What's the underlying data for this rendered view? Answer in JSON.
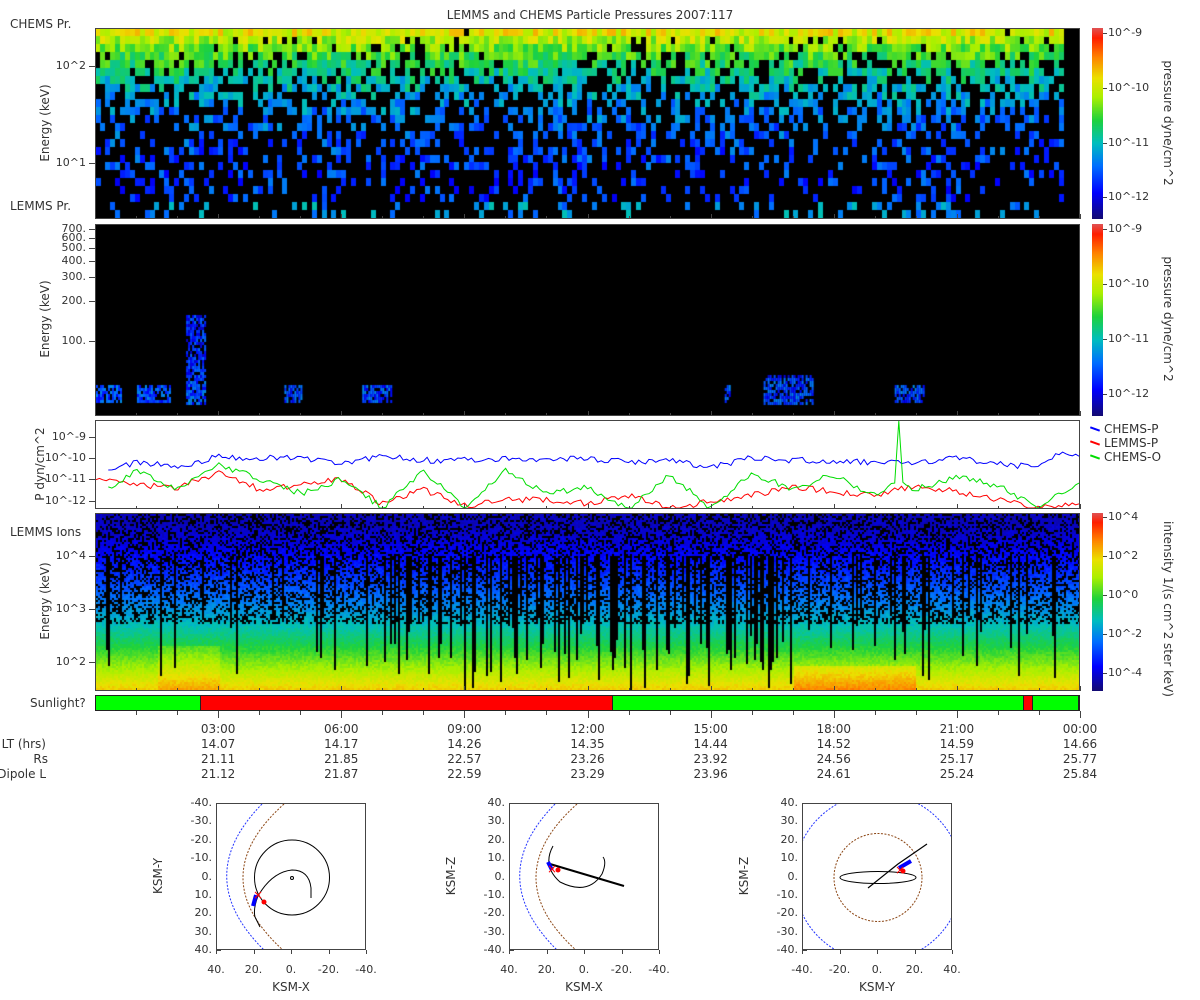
{
  "title": "LEMMS and CHEMS Particle Pressures  2007:117",
  "panel_labels": {
    "chems_pr": "CHEMS Pr.",
    "lemms_pr": "LEMMS Pr.",
    "lemms_ions": "LEMMS Ions",
    "sunlight": "Sunlight?"
  },
  "colors": {
    "chems_p": "#0000ff",
    "lemms_p": "#ff0000",
    "chems_o": "#00dd00",
    "sunlit": "#00ff00",
    "shadow": "#ff0000"
  },
  "chart_data": [
    {
      "type": "heatmap",
      "name": "CHEMS Pr.",
      "ylabel": "Energy (keV)",
      "yscale": "log",
      "ylim": [
        2.6,
        250
      ],
      "yticks": [
        {
          "v": 100,
          "label": "10^2"
        },
        {
          "v": 10,
          "label": "10^1"
        }
      ],
      "colorbar": {
        "label": "pressure dyne/cm^2",
        "log_range": [
          -12.4,
          -8.9
        ],
        "ticks": [
          {
            "v": -9,
            "label": "10^-9"
          },
          {
            "v": -10,
            "label": "10^-10"
          },
          {
            "v": -11,
            "label": "10^-11"
          },
          {
            "v": -12,
            "label": "10^-12"
          }
        ]
      }
    },
    {
      "type": "heatmap",
      "name": "LEMMS Pr.",
      "ylabel": "Energy (keV)",
      "yscale": "log",
      "ylim": [
        27,
        760
      ],
      "yticks": [
        {
          "v": 700,
          "label": "700."
        },
        {
          "v": 600,
          "label": "600."
        },
        {
          "v": 500,
          "label": "500."
        },
        {
          "v": 400,
          "label": "400."
        },
        {
          "v": 300,
          "label": "300."
        },
        {
          "v": 200,
          "label": "200."
        },
        {
          "v": 100,
          "label": "100."
        }
      ],
      "active_intervals_hours": [
        [
          0.0,
          0.6
        ],
        [
          1.0,
          1.8
        ],
        [
          2.2,
          2.65
        ],
        [
          4.6,
          5.0
        ],
        [
          6.5,
          7.2
        ],
        [
          15.35,
          15.45
        ],
        [
          16.3,
          17.5
        ],
        [
          19.5,
          20.2
        ]
      ],
      "colorbar": {
        "label": "pressure dyne/cm^2",
        "log_range": [
          -12.4,
          -8.9
        ],
        "ticks": [
          {
            "v": -9,
            "label": "10^-9"
          },
          {
            "v": -10,
            "label": "10^-10"
          },
          {
            "v": -11,
            "label": "10^-11"
          },
          {
            "v": -12,
            "label": "10^-12"
          }
        ]
      }
    },
    {
      "type": "line",
      "name": "Pressures",
      "ylabel": "P dyn/cm^2",
      "yscale": "log",
      "ylim_log10": [
        -12.4,
        -8.2
      ],
      "yticks": [
        {
          "v": -9,
          "label": "10^-9"
        },
        {
          "v": -10,
          "label": "10^-10"
        },
        {
          "v": -11,
          "label": "10^-11"
        },
        {
          "v": -12,
          "label": "10^-12"
        }
      ],
      "xlim_hours": [
        0,
        24
      ],
      "legend_position": "right",
      "series": [
        {
          "name": "CHEMS-P",
          "color": "#0000ff",
          "x": [
            0.3,
            1,
            2,
            3,
            4,
            5,
            6,
            7,
            8,
            9,
            10,
            11,
            12,
            13,
            14,
            15,
            16,
            17,
            18,
            19,
            20,
            21,
            22,
            23,
            23.6,
            24
          ],
          "y_log10": [
            -10.5,
            -10.2,
            -10.4,
            -9.9,
            -10.0,
            -10.0,
            -10.3,
            -9.9,
            -10.1,
            -10.1,
            -10.0,
            -10.1,
            -10.0,
            -10.2,
            -10.1,
            -10.4,
            -10.0,
            -10.1,
            -10.1,
            -10.2,
            -10.2,
            -10.0,
            -10.3,
            -10.4,
            -9.6,
            -9.9
          ]
        },
        {
          "name": "LEMMS-P",
          "color": "#ff0000",
          "x": [
            0,
            1,
            2,
            3,
            4,
            5,
            6,
            7,
            8,
            9,
            10,
            11,
            12,
            13,
            14,
            15,
            16,
            17,
            18,
            19,
            20,
            21,
            22,
            23,
            24
          ],
          "y_log10": [
            -11.0,
            -11.3,
            -11.4,
            -10.7,
            -11.5,
            -11.3,
            -11.0,
            -12.2,
            -11.5,
            -12.3,
            -12.0,
            -12.0,
            -12.2,
            -11.8,
            -12.4,
            -12.1,
            -11.8,
            -11.4,
            -11.6,
            -11.8,
            -11.3,
            -11.6,
            -12.0,
            -12.4,
            -12.2
          ]
        },
        {
          "name": "CHEMS-O",
          "color": "#00dd00",
          "x": [
            0.3,
            1,
            2,
            3,
            4,
            5,
            6,
            7,
            8,
            9,
            10,
            11,
            12,
            13,
            14,
            15,
            16,
            17,
            18,
            19,
            19.5,
            19.6,
            19.7,
            20,
            21,
            22,
            23,
            24
          ],
          "y_log10": [
            -11.5,
            -10.6,
            -11.5,
            -10.3,
            -11.0,
            -11.7,
            -11.0,
            -12.4,
            -10.6,
            -12.4,
            -10.6,
            -11.7,
            -11.4,
            -12.4,
            -10.8,
            -12.4,
            -10.7,
            -11.5,
            -10.8,
            -11.8,
            -11.2,
            -8.2,
            -11.2,
            -11.5,
            -10.9,
            -11.3,
            -12.4,
            -11.2
          ]
        }
      ]
    },
    {
      "type": "heatmap",
      "name": "LEMMS Ions",
      "ylabel": "Energy (keV)",
      "yscale": "log",
      "ylim": [
        28,
        66000
      ],
      "yticks": [
        {
          "v": 10000,
          "label": "10^4"
        },
        {
          "v": 1000,
          "label": "10^3"
        },
        {
          "v": 100,
          "label": "10^2"
        }
      ],
      "colorbar": {
        "label": "intensity 1/(s cm^2 ster keV)",
        "log_range": [
          -4.9,
          4.2
        ],
        "ticks": [
          {
            "v": 4,
            "label": "10^4"
          },
          {
            "v": 2,
            "label": "10^2"
          },
          {
            "v": 0,
            "label": "10^0"
          },
          {
            "v": -2,
            "label": "10^-2"
          },
          {
            "v": -4,
            "label": "10^-4"
          }
        ]
      }
    }
  ],
  "sunlight": [
    {
      "from": 0,
      "to": 2.56,
      "state": "sunlit"
    },
    {
      "from": 2.56,
      "to": 12.63,
      "state": "shadow"
    },
    {
      "from": 12.63,
      "to": 22.66,
      "state": "sunlit"
    },
    {
      "from": 22.66,
      "to": 22.88,
      "state": "shadow"
    },
    {
      "from": 22.88,
      "to": 24,
      "state": "sunlit"
    }
  ],
  "time_axis": {
    "row_labels": [
      "LT (hrs)",
      "Rs",
      "Dipole L"
    ],
    "ticks": [
      {
        "hour": 3,
        "time": "03:00",
        "lt": "14.07",
        "rs": "21.11",
        "l": "21.12"
      },
      {
        "hour": 6,
        "time": "06:00",
        "lt": "14.17",
        "rs": "21.85",
        "l": "21.87"
      },
      {
        "hour": 9,
        "time": "09:00",
        "lt": "14.26",
        "rs": "22.57",
        "l": "22.59"
      },
      {
        "hour": 12,
        "time": "12:00",
        "lt": "14.35",
        "rs": "23.26",
        "l": "23.29"
      },
      {
        "hour": 15,
        "time": "15:00",
        "lt": "14.44",
        "rs": "23.92",
        "l": "23.96"
      },
      {
        "hour": 18,
        "time": "18:00",
        "lt": "14.52",
        "rs": "24.56",
        "l": "24.61"
      },
      {
        "hour": 21,
        "time": "21:00",
        "lt": "14.59",
        "rs": "25.17",
        "l": "25.24"
      },
      {
        "hour": 24,
        "time": "00:00",
        "lt": "14.66",
        "rs": "25.77",
        "l": "25.84"
      }
    ]
  },
  "orbits": [
    {
      "xlabel": "KSM-X",
      "ylabel": "KSM-Y",
      "xticks": [
        "40.",
        "20.",
        "0.",
        "-20.",
        "-40."
      ],
      "yticks": [
        "-40.",
        "-30.",
        "-20.",
        "-10.",
        "0.",
        "10.",
        "20.",
        "30.",
        "40."
      ]
    },
    {
      "xlabel": "KSM-X",
      "ylabel": "KSM-Z",
      "xticks": [
        "40.",
        "20.",
        "0.",
        "-20.",
        "-40."
      ],
      "yticks": [
        "40.",
        "30.",
        "20.",
        "10.",
        "0.",
        "-10.",
        "-20.",
        "-30.",
        "-40."
      ]
    },
    {
      "xlabel": "KSM-Y",
      "ylabel": "KSM-Z",
      "xticks": [
        "-40.",
        "-20.",
        "0.",
        "20.",
        "40."
      ],
      "yticks": [
        "40.",
        "30.",
        "20.",
        "10.",
        "0.",
        "-10.",
        "-20.",
        "-30.",
        "-40."
      ]
    }
  ]
}
